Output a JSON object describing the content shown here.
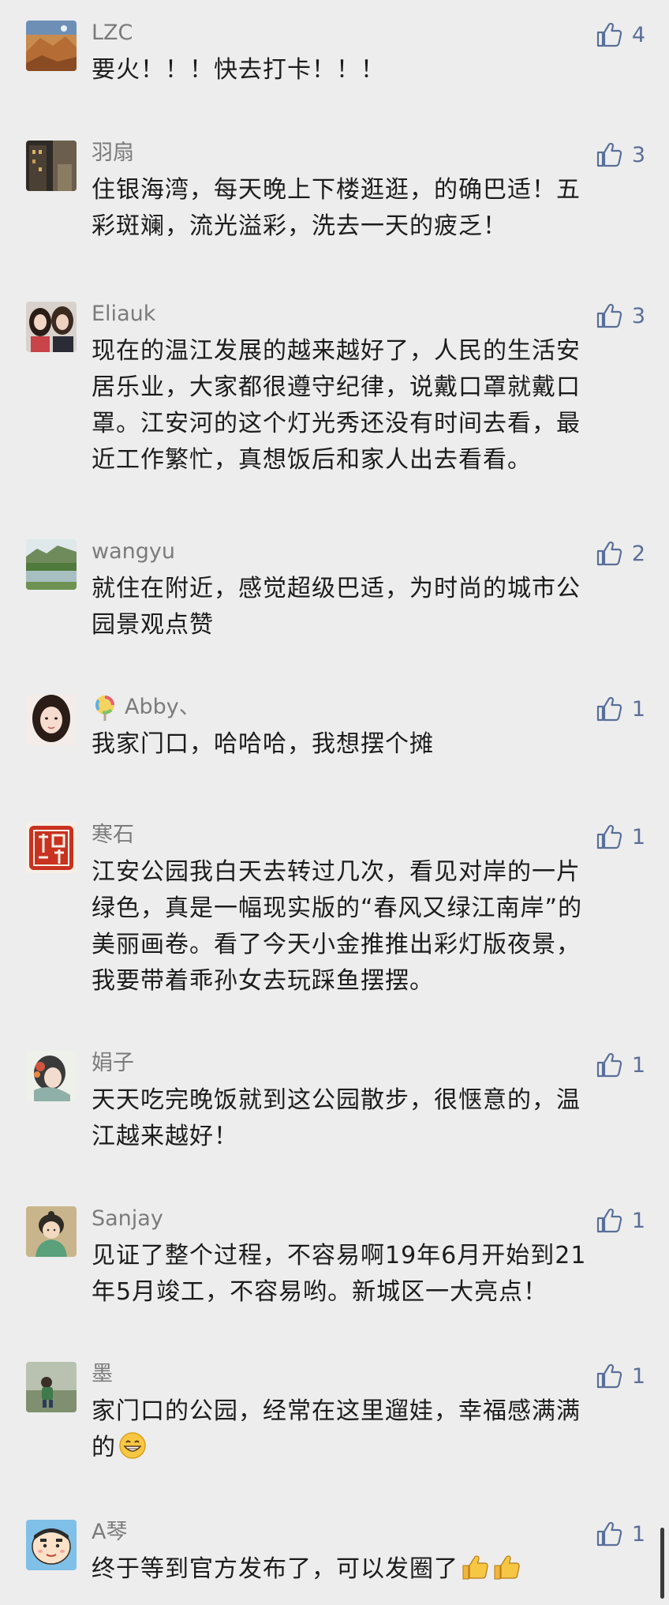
{
  "comments": [
    {
      "nickname": "LZC",
      "likes": "4",
      "avatar_icon": "desert-rock-avatar",
      "lines": [
        "要火！！！快去打卡！！！"
      ]
    },
    {
      "nickname": "羽扇",
      "likes": "3",
      "avatar_icon": "dark-building-avatar",
      "lines": [
        "住银海湾，每天晚上下楼逛逛，的确巴适！五",
        "彩斑斓，流光溢彩，洗去一天的疲乏！"
      ]
    },
    {
      "nickname": "Eliauk",
      "likes": "3",
      "avatar_icon": "two-girls-avatar",
      "lines": [
        "现在的温江发展的越来越好了，人民的生活安",
        "居乐业，大家都很遵守纪律，说戴口罩就戴口",
        "罩。江安河的这个灯光秀还没有时间去看，最",
        "近工作繁忙，真想饭后和家人出去看看。"
      ]
    },
    {
      "nickname": "wangyu",
      "likes": "2",
      "avatar_icon": "lake-landscape-avatar",
      "lines": [
        "就住在附近，感觉超级巴适，为时尚的城市公",
        "园景观点赞"
      ]
    },
    {
      "nickname": "Abby、",
      "nickname_emoji": "lollipop-icon",
      "likes": "1",
      "avatar_icon": "girl-portrait-avatar",
      "lines": [
        "我家门口，哈哈哈，我想摆个摊"
      ]
    },
    {
      "nickname": "寒石",
      "likes": "1",
      "avatar_icon": "red-seal-avatar",
      "lines": [
        "江安公园我白天去转过几次，看见对岸的一片",
        "绿色，真是一幅现实版的“春风又绿江南岸”的",
        "美丽画卷。看了今天小金推推出彩灯版夜景，",
        "我要带着乖孙女去玩踩鱼摆摆。"
      ]
    },
    {
      "nickname": "娟子",
      "likes": "1",
      "avatar_icon": "painted-lady-avatar",
      "lines": [
        "天天吃完晚饭就到这公园散步，很惬意的，温",
        "江越来越好！"
      ]
    },
    {
      "nickname": "Sanjay",
      "likes": "1",
      "avatar_icon": "cartoon-girl-avatar",
      "lines": [
        "见证了整个过程，不容易啊19年6月开始到21",
        "年5月竣工，不容易哟。新城区一大亮点！"
      ]
    },
    {
      "nickname": "墨",
      "likes": "1",
      "avatar_icon": "child-outdoor-avatar",
      "lines": [
        "家门口的公园，经常在这里遛娃，幸福感满满",
        "的"
      ],
      "trailing_emoji": "grin-emoji"
    },
    {
      "nickname": "A琴",
      "likes": "1",
      "avatar_icon": "crayon-shinchan-avatar",
      "lines": [
        "终于等到官方发布了，可以发圈了"
      ],
      "trailing_emoji": "thumbs-up-emoji-x2"
    }
  ],
  "colors": {
    "background": "#ededed",
    "nickname": "#7b7b7b",
    "text": "#1c1c1c",
    "like_accent": "#5a6f98"
  }
}
